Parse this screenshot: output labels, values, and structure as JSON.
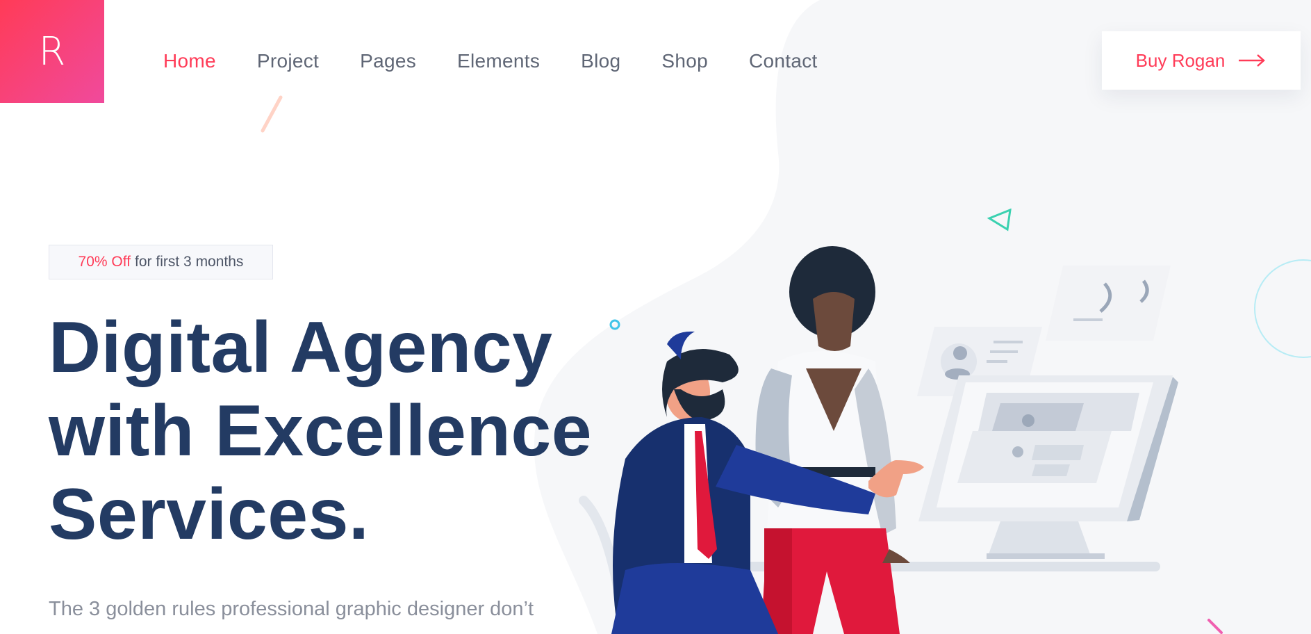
{
  "brand": {
    "logo_letter": "R"
  },
  "nav": {
    "items": [
      {
        "label": "Home",
        "active": true
      },
      {
        "label": "Project",
        "active": false
      },
      {
        "label": "Pages",
        "active": false
      },
      {
        "label": "Elements",
        "active": false
      },
      {
        "label": "Blog",
        "active": false
      },
      {
        "label": "Shop",
        "active": false
      },
      {
        "label": "Contact",
        "active": false
      }
    ]
  },
  "cta": {
    "label": "Buy Rogan",
    "icon": "arrow-right-icon"
  },
  "hero": {
    "badge_highlight": "70% Off",
    "badge_text": "for first 3 months",
    "title_lines": [
      "Digital Agency",
      "with Excellence",
      "Services."
    ],
    "subtitle": "The 3 golden rules professional graphic designer don’t"
  },
  "colors": {
    "accent": "#ff3b57",
    "title": "#233b63",
    "nav_text": "#5f6675",
    "subtitle": "#8a8f9b",
    "logo_gradient_end": "#f04a9c"
  }
}
